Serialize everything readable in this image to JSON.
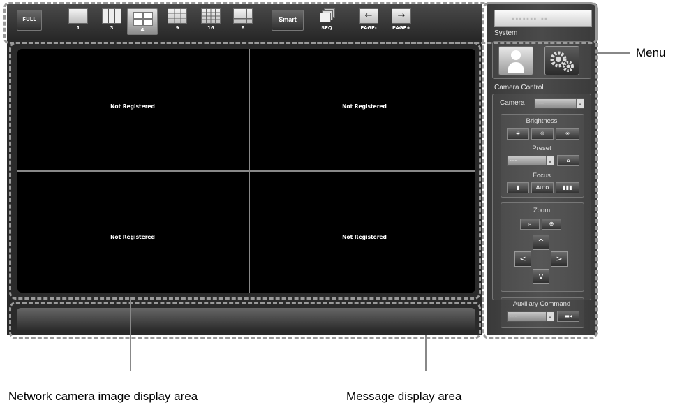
{
  "toolbar": {
    "full_label": "FULL",
    "layouts": [
      {
        "label": "1"
      },
      {
        "label": "3"
      },
      {
        "label": "4"
      },
      {
        "label": "9"
      },
      {
        "label": "16"
      },
      {
        "label": "8"
      }
    ],
    "smart_label": "Smart",
    "seq_label": "SEQ",
    "page_minus_label": "PAGE-",
    "page_plus_label": "PAGE+"
  },
  "cells": [
    {
      "text": "Not Registered"
    },
    {
      "text": "Not Registered"
    },
    {
      "text": "Not Registered"
    },
    {
      "text": "Not Registered"
    }
  ],
  "panel": {
    "system_label": "System",
    "camera_control_label": "Camera Control",
    "camera_label": "Camera",
    "camera_value": "----",
    "brightness_label": "Brightness",
    "preset_label": "Preset",
    "preset_value": "----",
    "focus_label": "Focus",
    "focus_auto_label": "Auto",
    "zoom_label": "Zoom",
    "up_label": "^",
    "left_label": "<",
    "right_label": ">",
    "down_label": "v",
    "aux_label": "Auxiliary Command",
    "aux_value": "----"
  },
  "annotations": {
    "menu": "Menu",
    "camera_area": "Network camera image display area",
    "message_area": "Message display area"
  }
}
